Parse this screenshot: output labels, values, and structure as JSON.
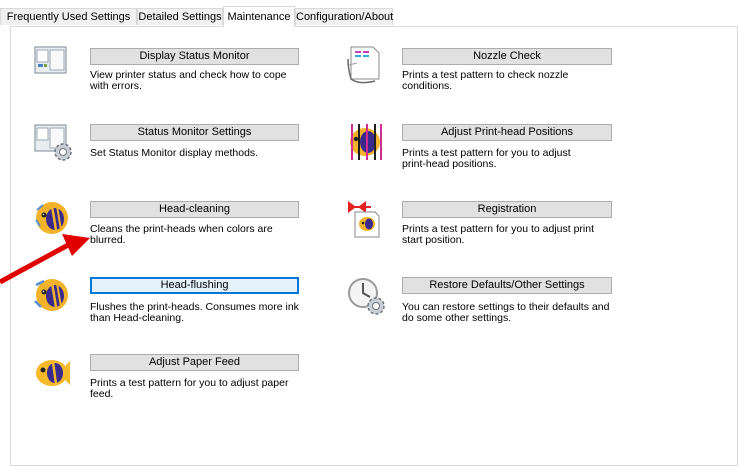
{
  "tabs": [
    {
      "label": "Frequently Used Settings",
      "active": false
    },
    {
      "label": "Detailed Settings",
      "active": false
    },
    {
      "label": "Maintenance",
      "active": true
    },
    {
      "label": "Configuration/About",
      "active": false
    }
  ],
  "left_items": [
    {
      "button": "Display Status Monitor",
      "desc1": "View printer status and check how to cope",
      "desc2": "with errors.",
      "icon": "status-monitor-icon"
    },
    {
      "button": "Status Monitor Settings",
      "desc1": "Set Status Monitor display methods.",
      "desc2": "",
      "icon": "status-monitor-settings-icon"
    },
    {
      "button": "Head-cleaning",
      "desc1": "Cleans the print-heads when colors are",
      "desc2": "blurred.",
      "icon": "head-cleaning-icon"
    },
    {
      "button": "Head-flushing",
      "desc1": "Flushes the print-heads. Consumes more ink",
      "desc2": "than Head-cleaning.",
      "icon": "head-flushing-icon"
    },
    {
      "button": "Adjust Paper Feed",
      "desc1": "Prints a test pattern for you to adjust paper",
      "desc2": "feed.",
      "icon": "adjust-paper-feed-icon"
    }
  ],
  "right_items": [
    {
      "button": "Nozzle Check",
      "desc1": "Prints a test pattern to check nozzle",
      "desc2": "conditions.",
      "icon": "nozzle-check-icon"
    },
    {
      "button": "Adjust Print-head Positions",
      "desc1": "Prints a test pattern for you to adjust",
      "desc2": "print-head positions.",
      "icon": "adjust-print-head-icon"
    },
    {
      "button": "Registration",
      "desc1": "Prints a test pattern for you to adjust print",
      "desc2": "start position.",
      "icon": "registration-icon"
    },
    {
      "button": "Restore Defaults/Other Settings",
      "desc1": "You can restore settings to their defaults and",
      "desc2": "do some other settings.",
      "icon": "restore-defaults-icon"
    }
  ],
  "focused_button": "Head-flushing",
  "colors": {
    "annotation_arrow": "#e00000",
    "focus_border": "#0078d7",
    "button_face": "#e1e1e1"
  }
}
